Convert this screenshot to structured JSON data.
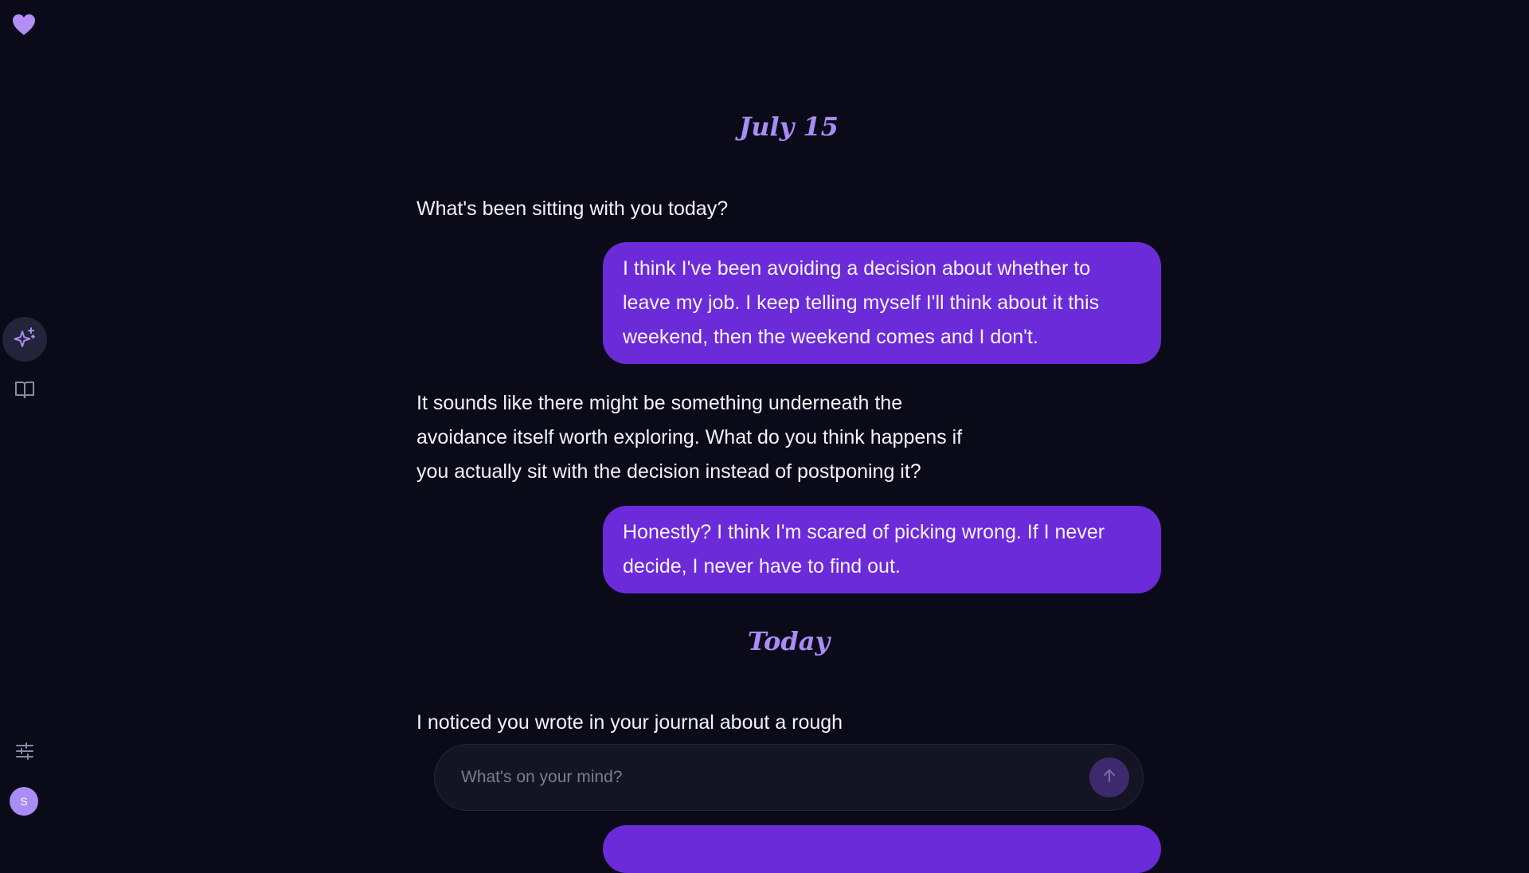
{
  "app": {
    "icons": {
      "logo": "heart-icon",
      "reflect": "sparkles-icon",
      "journal": "book-open-icon",
      "settings": "sliders-icon"
    },
    "user_initial": "S"
  },
  "colors": {
    "background": "#0a0a19",
    "accent": "#a98cf4",
    "user_bubble": "#6c2bd9",
    "composer_bg": "#141424"
  },
  "conversation": {
    "sections": [
      {
        "date": "July 15",
        "messages": [
          {
            "role": "assistant",
            "text": "What's been sitting with you today?"
          },
          {
            "role": "user",
            "text": "I think I've been avoiding a decision about whether to leave my job. I keep telling myself I'll think about it this weekend, then the weekend comes and I don't."
          },
          {
            "role": "assistant",
            "text": "It sounds like there might be something underneath the avoidance itself worth exploring. What do you think happens if you actually sit with the decision instead of postponing it?"
          },
          {
            "role": "user",
            "text": "Honestly? I think I'm scared of picking wrong. If I never decide, I never have to find out."
          }
        ]
      },
      {
        "date": "Today",
        "messages": [
          {
            "role": "assistant",
            "text": "I noticed you wrote in your journal about a rough"
          }
        ]
      }
    ]
  },
  "composer": {
    "placeholder": "What's on your mind?",
    "send_icon": "arrow-up-icon"
  }
}
